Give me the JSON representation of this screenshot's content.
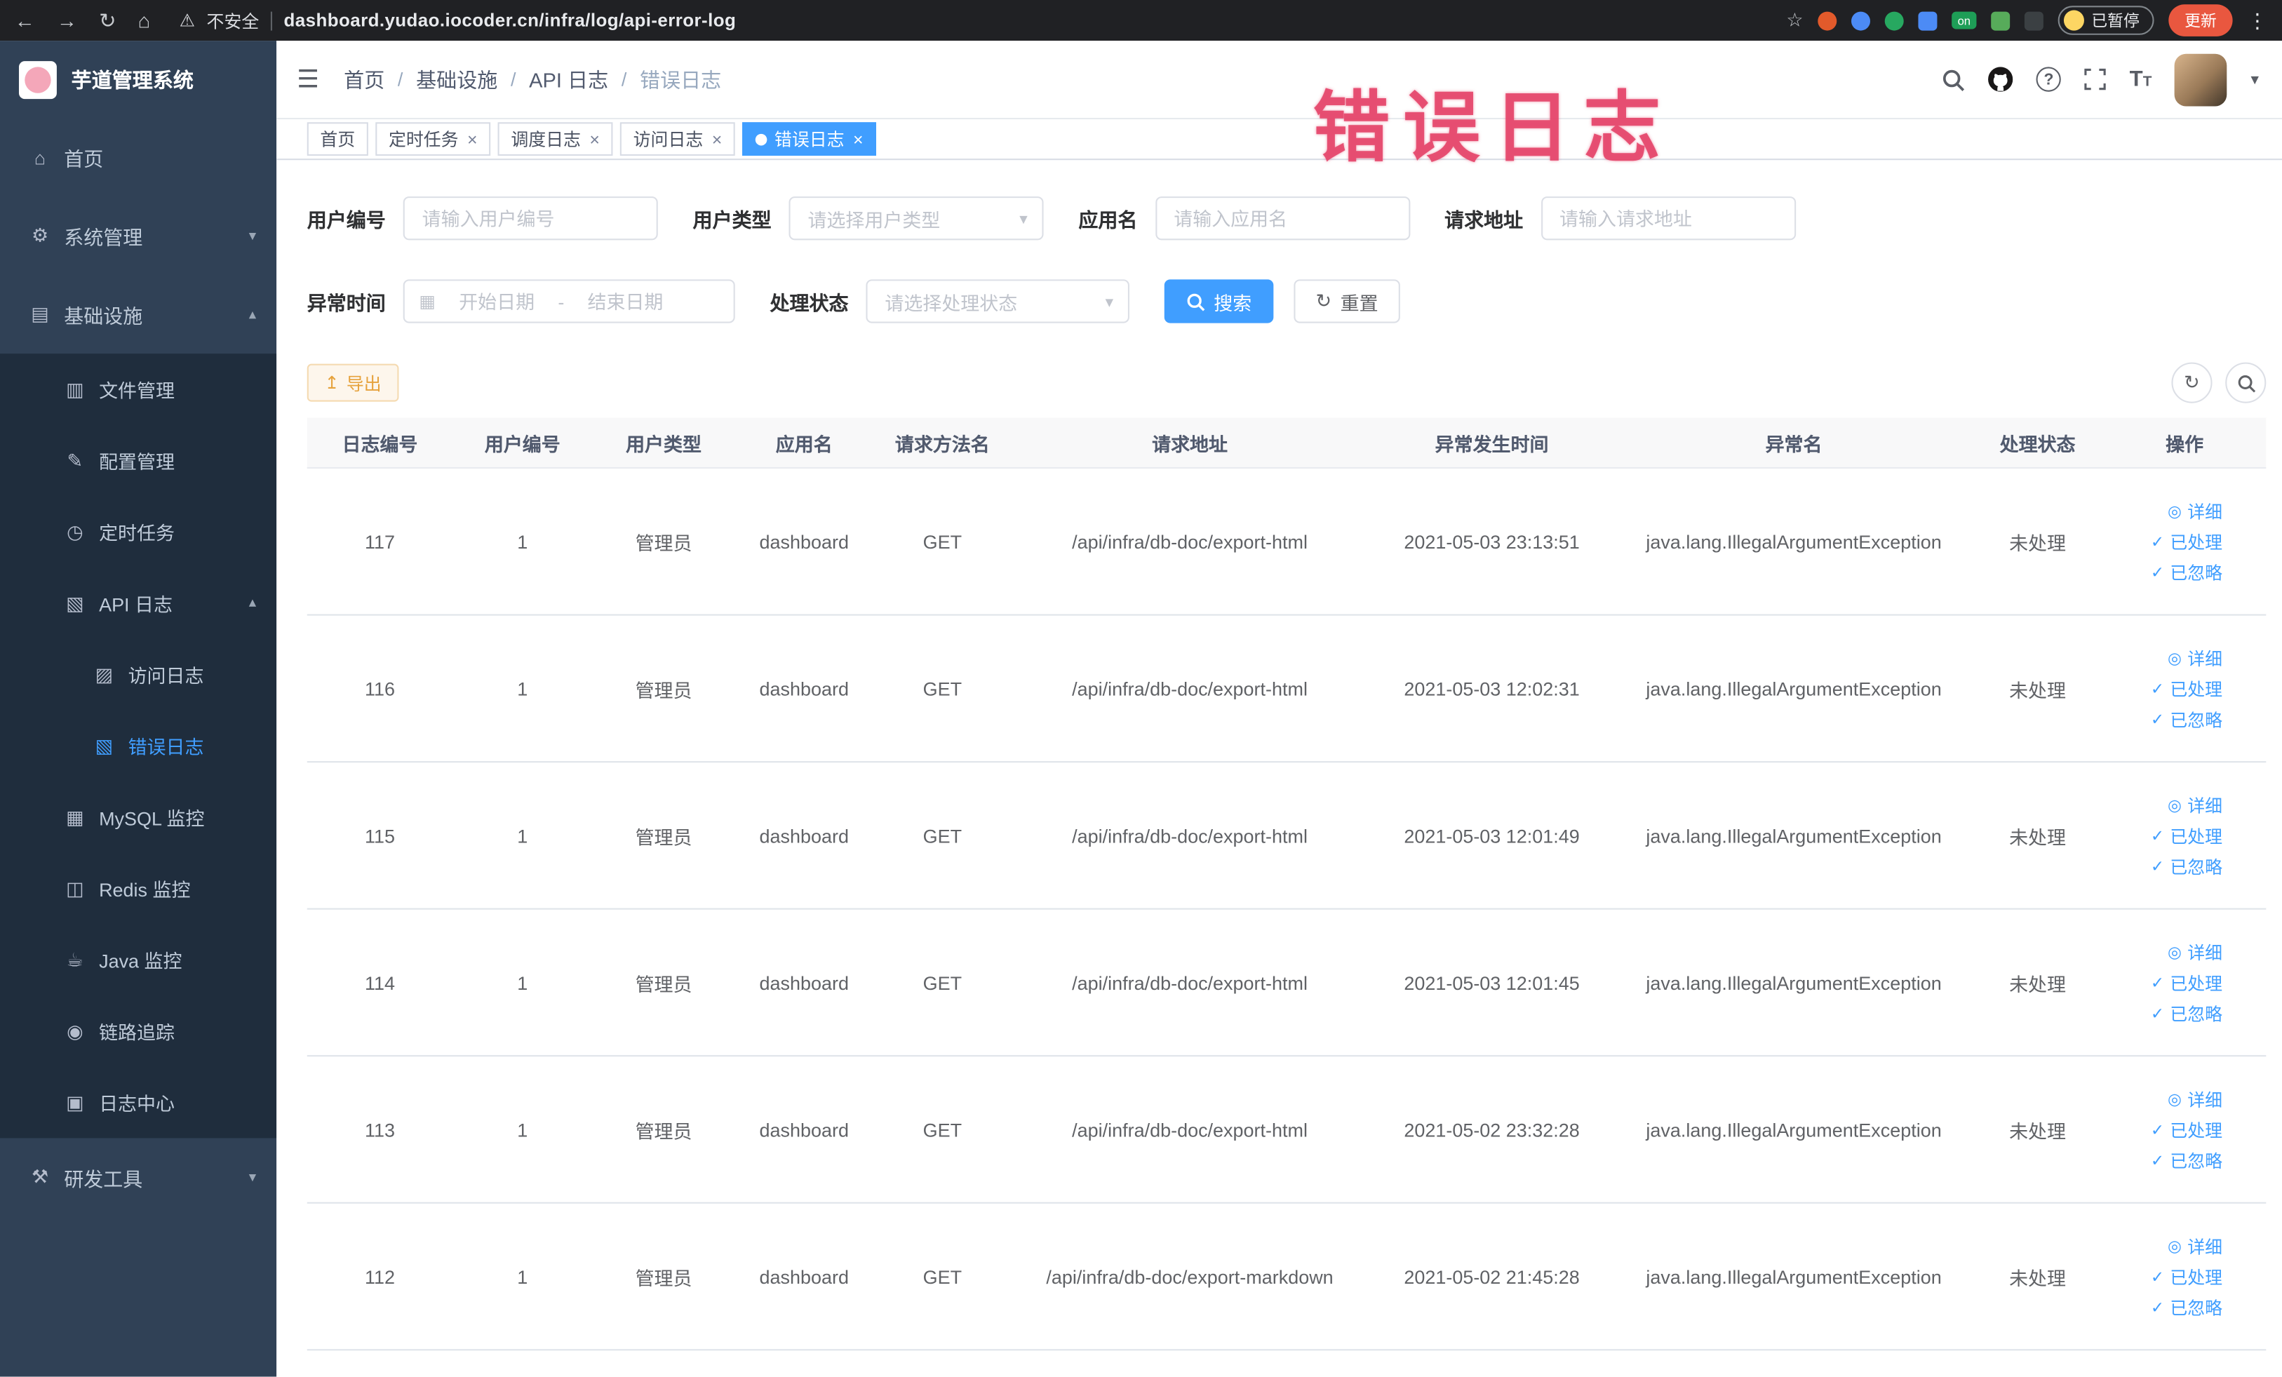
{
  "browser": {
    "warning_text": "不安全",
    "url": "dashboard.yudao.iocoder.cn/infra/log/api-error-log",
    "on_badge": "on",
    "paused_badge": "已暂停",
    "update_label": "更新",
    "extension_colors": [
      "#e25a2b",
      "#4c8bf5",
      "#27a860",
      "#4c8bf5",
      "#1e9e57",
      "#57ab5a",
      "#3b4043"
    ]
  },
  "sidebar": {
    "logo_title": "芋道管理系统",
    "items": [
      {
        "label": "首页"
      },
      {
        "label": "系统管理"
      },
      {
        "label": "基础设施"
      },
      {
        "label": "文件管理"
      },
      {
        "label": "配置管理"
      },
      {
        "label": "定时任务"
      },
      {
        "label": "API 日志"
      },
      {
        "label": "访问日志"
      },
      {
        "label": "错误日志"
      },
      {
        "label": "MySQL 监控"
      },
      {
        "label": "Redis 监控"
      },
      {
        "label": "Java 监控"
      },
      {
        "label": "链路追踪"
      },
      {
        "label": "日志中心"
      },
      {
        "label": "研发工具"
      }
    ]
  },
  "navbar": {
    "breadcrumb": [
      "首页",
      "基础设施",
      "API 日志",
      "错误日志"
    ]
  },
  "watermark": "错误日志",
  "tabs": [
    {
      "label": "首页"
    },
    {
      "label": "定时任务"
    },
    {
      "label": "调度日志"
    },
    {
      "label": "访问日志"
    },
    {
      "label": "错误日志"
    }
  ],
  "filters": {
    "user_id_label": "用户编号",
    "user_id_placeholder": "请输入用户编号",
    "user_type_label": "用户类型",
    "user_type_placeholder": "请选择用户类型",
    "app_name_label": "应用名",
    "app_name_placeholder": "请输入应用名",
    "request_url_label": "请求地址",
    "request_url_placeholder": "请输入请求地址",
    "exception_time_label": "异常时间",
    "date_start_placeholder": "开始日期",
    "date_separator": "-",
    "date_end_placeholder": "结束日期",
    "process_status_label": "处理状态",
    "process_status_placeholder": "请选择处理状态",
    "search_label": "搜索",
    "reset_label": "重置"
  },
  "toolbar": {
    "export_label": "导出"
  },
  "table": {
    "columns": [
      "日志编号",
      "用户编号",
      "用户类型",
      "应用名",
      "请求方法名",
      "请求地址",
      "异常发生时间",
      "异常名",
      "处理状态",
      "操作"
    ],
    "actions": {
      "detail": "详细",
      "processed": "已处理",
      "ignored": "已忽略"
    },
    "rows": [
      {
        "id": "117",
        "user_id": "1",
        "user_type": "管理员",
        "app": "dashboard",
        "method": "GET",
        "url": "/api/infra/db-doc/export-html",
        "time": "2021-05-03 23:13:51",
        "exception": "java.lang.IllegalArgumentException",
        "status": "未处理"
      },
      {
        "id": "116",
        "user_id": "1",
        "user_type": "管理员",
        "app": "dashboard",
        "method": "GET",
        "url": "/api/infra/db-doc/export-html",
        "time": "2021-05-03 12:02:31",
        "exception": "java.lang.IllegalArgumentException",
        "status": "未处理"
      },
      {
        "id": "115",
        "user_id": "1",
        "user_type": "管理员",
        "app": "dashboard",
        "method": "GET",
        "url": "/api/infra/db-doc/export-html",
        "time": "2021-05-03 12:01:49",
        "exception": "java.lang.IllegalArgumentException",
        "status": "未处理"
      },
      {
        "id": "114",
        "user_id": "1",
        "user_type": "管理员",
        "app": "dashboard",
        "method": "GET",
        "url": "/api/infra/db-doc/export-html",
        "time": "2021-05-03 12:01:45",
        "exception": "java.lang.IllegalArgumentException",
        "status": "未处理"
      },
      {
        "id": "113",
        "user_id": "1",
        "user_type": "管理员",
        "app": "dashboard",
        "method": "GET",
        "url": "/api/infra/db-doc/export-html",
        "time": "2021-05-02 23:32:28",
        "exception": "java.lang.IllegalArgumentException",
        "status": "未处理"
      },
      {
        "id": "112",
        "user_id": "1",
        "user_type": "管理员",
        "app": "dashboard",
        "method": "GET",
        "url": "/api/infra/db-doc/export-markdown",
        "time": "2021-05-02 21:45:28",
        "exception": "java.lang.IllegalArgumentException",
        "status": "未处理"
      }
    ]
  },
  "icons": {
    "back": "←",
    "forward": "→",
    "reload": "↻",
    "home_nav": "⌂",
    "warning": "⚠",
    "star": "☆",
    "kebab": "⋮",
    "hamburger": "☰",
    "home": "⌂",
    "gear": "⚙",
    "infra": "▤",
    "file": "▥",
    "config": "✎",
    "job": "◷",
    "api_log": "▧",
    "access_log": "▨",
    "error_log": "▧",
    "mysql": "▦",
    "redis": "◫",
    "java": "☕",
    "trace": "◉",
    "log_center": "▣",
    "tools": "⚒",
    "chevron_down": "▾",
    "chevron_up": "▴",
    "caret_down": "▾",
    "refresh": "↻",
    "export": "↥",
    "calendar": "▦",
    "eye": "◎",
    "check": "✓",
    "close": "×"
  },
  "colors": {
    "primary": "#409eff",
    "sidebar_bg": "#304156",
    "submenu_bg": "#1f2d3d",
    "export_text": "#e6a23c",
    "watermark": "#e5476b",
    "browser_bg": "#202124"
  }
}
